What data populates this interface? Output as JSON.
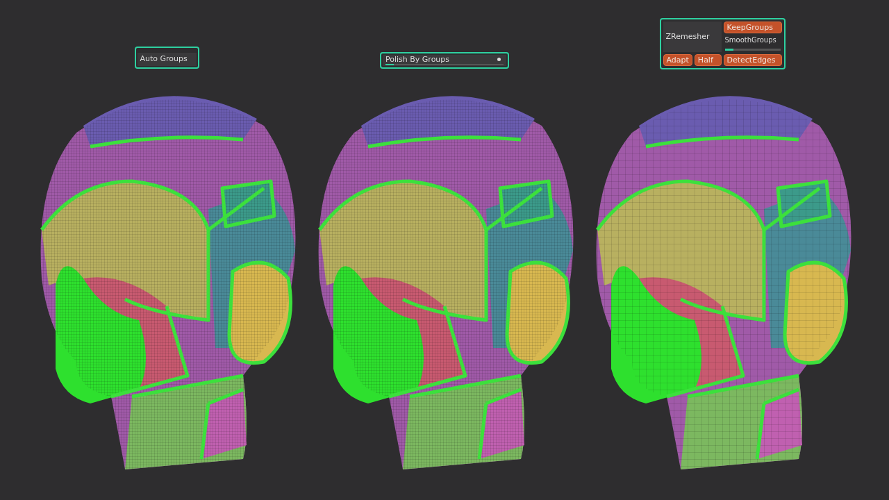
{
  "auto_groups": {
    "label": "Auto Groups"
  },
  "polish_by_groups": {
    "label": "Polish By Groups",
    "level": 0.07
  },
  "zremesher": {
    "title": "ZRemesher",
    "smooth_groups": {
      "label": "SmoothGroups",
      "level": 0.15
    },
    "buttons": [
      {
        "label": "KeepGroups",
        "on": true
      },
      {
        "label": "Adapt",
        "on": true
      },
      {
        "label": "Half",
        "on": true
      },
      {
        "label": "DetectEdges",
        "on": true
      }
    ]
  }
}
